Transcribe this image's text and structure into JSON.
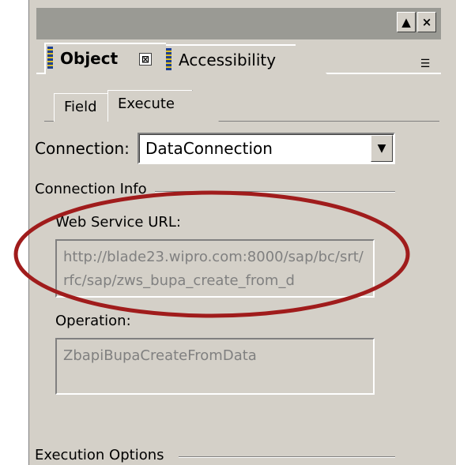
{
  "title_controls": {
    "collapse_glyph": "▲",
    "close_glyph": "×"
  },
  "palette_tabs": {
    "object_label": "Object",
    "object_close_glyph": "⊠",
    "accessibility_label": "Accessibility",
    "menu_glyph": "☰"
  },
  "sub_tabs": {
    "field_label": "Field",
    "execute_label": "Execute"
  },
  "connection": {
    "label": "Connection:",
    "selected": "DataConnection",
    "dropdown_glyph": "▼"
  },
  "connection_info": {
    "heading": "Connection Info",
    "web_service_url_label": "Web Service URL:",
    "web_service_url_value": "http://blade23.wipro.com:8000/sap/bc/srt/rfc/sap/zws_bupa_create_from_d",
    "operation_label": "Operation:",
    "operation_value": "ZbapiBupaCreateFromData"
  },
  "execution_options": {
    "heading": "Execution Options"
  },
  "colors": {
    "panel_bg": "#d4d0c8",
    "highlight_ellipse": "#a01c1c",
    "disabled_text": "#808080"
  }
}
